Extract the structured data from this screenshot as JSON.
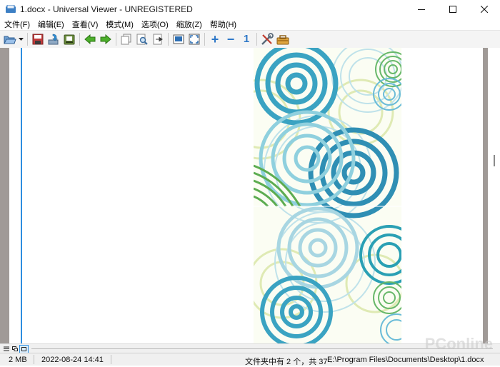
{
  "window": {
    "title": "1.docx - Universal Viewer - UNREGISTERED"
  },
  "menu": {
    "items": [
      "文件(F)",
      "编辑(E)",
      "查看(V)",
      "模式(M)",
      "选项(O)",
      "缩放(Z)",
      "帮助(H)"
    ]
  },
  "toolbar": {
    "buttons": [
      "open-icon",
      "save-icon",
      "reload-icon",
      "print-icon",
      "back-arrow-icon",
      "forward-arrow-icon",
      "copy-icon",
      "find-icon",
      "exit-icon",
      "fit-window-icon",
      "fullscreen-icon",
      "zoom-in-icon",
      "zoom-out-icon",
      "zoom-original-icon",
      "settings-tools-icon",
      "plugins-icon"
    ],
    "zoom_in_glyph": "+",
    "zoom_out_glyph": "−",
    "original_glyph": "1"
  },
  "colors": {
    "accent_blue": "#2d8ee0",
    "gutter": "#a09a97"
  },
  "statusbar": {
    "size": "2 MB",
    "date": "2022-08-24 14:41",
    "file_info": "文件夹中有 2 个，共 37 ·",
    "path": "E:\\Program Files\\Documents\\Desktop\\1.docx"
  },
  "watermark": "PConline"
}
